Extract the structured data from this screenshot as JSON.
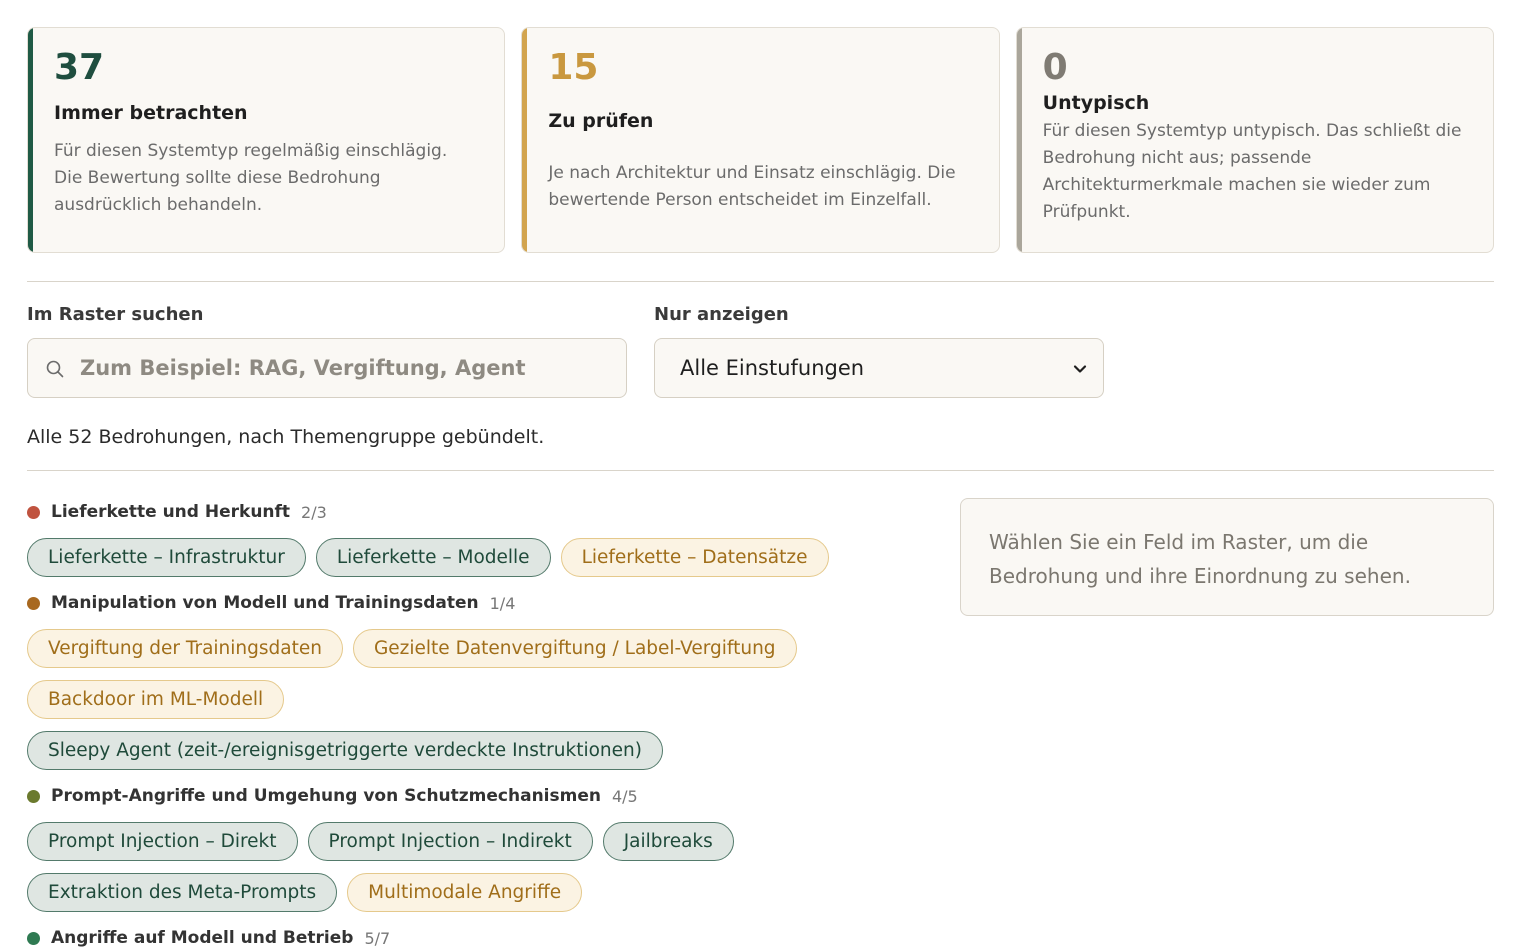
{
  "summary": {
    "cards": [
      {
        "count": "37",
        "title": "Immer betrachten",
        "desc": "Für diesen Systemtyp regelmäßig einschlägig. Die Bewertung sollte diese Bedrohung ausdrücklich behandeln.",
        "tone": "green"
      },
      {
        "count": "15",
        "title": "Zu prüfen",
        "desc": "Je nach Architektur und Einsatz einschlägig. Die bewertende Person entscheidet im Einzelfall.",
        "tone": "amber"
      },
      {
        "count": "0",
        "title": "Untypisch",
        "desc": "Für diesen Systemtyp untypisch. Das schließt die Bedrohung nicht aus; passende Architekturmerkmale machen sie wieder zum Prüfpunkt.",
        "tone": "gray"
      }
    ]
  },
  "search": {
    "label": "Im Raster suchen",
    "placeholder": "Zum Beispiel: RAG, Vergiftung, Agent",
    "icon": "search-icon"
  },
  "filter": {
    "label": "Nur anzeigen",
    "selected": "Alle Einstufungen",
    "icon": "chevron-down-icon"
  },
  "result_summary": "Alle 52 Bedrohungen, nach Themengruppe gebündelt.",
  "groups": [
    {
      "name": "Lieferkette und Herkunft",
      "count": "2/3",
      "color": "#c0533f",
      "tags": [
        {
          "label": "Lieferkette – Infrastruktur",
          "kind": "always"
        },
        {
          "label": "Lieferkette – Modelle",
          "kind": "always"
        },
        {
          "label": "Lieferkette – Datensätze",
          "kind": "check"
        }
      ]
    },
    {
      "name": "Manipulation von Modell und Trainingsdaten",
      "count": "1/4",
      "color": "#a8681f",
      "tags": [
        {
          "label": "Vergiftung der Trainingsdaten",
          "kind": "check"
        },
        {
          "label": "Gezielte Datenvergiftung / Label-Vergiftung",
          "kind": "check"
        },
        {
          "label": "Backdoor im ML-Modell",
          "kind": "check"
        },
        {
          "label": "Sleepy Agent (zeit-/ereignisgetriggerte verdeckte Instruktionen)",
          "kind": "always"
        }
      ]
    },
    {
      "name": "Prompt-Angriffe und Umgehung von Schutzmechanismen",
      "count": "4/5",
      "color": "#6b7a2e",
      "tags": [
        {
          "label": "Prompt Injection – Direkt",
          "kind": "always"
        },
        {
          "label": "Prompt Injection – Indirekt",
          "kind": "always"
        },
        {
          "label": "Jailbreaks",
          "kind": "always"
        },
        {
          "label": "Extraktion des Meta-Prompts",
          "kind": "always"
        },
        {
          "label": "Multimodale Angriffe",
          "kind": "check"
        }
      ]
    },
    {
      "name": "Angriffe auf Modell und Betrieb",
      "count": "5/7",
      "color": "#2f7a52",
      "tags": []
    }
  ],
  "detail": {
    "placeholder": "Wählen Sie ein Feld im Raster, um die Bedrohung und ihre Einordnung zu sehen."
  }
}
